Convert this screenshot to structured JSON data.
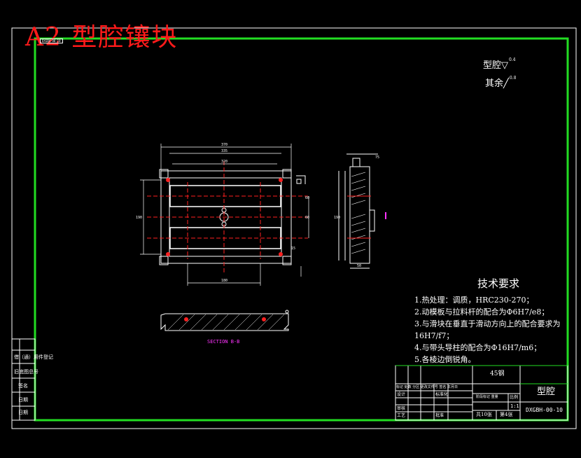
{
  "drawing": {
    "title": "A2 型腔镶块",
    "stamp": "DXGBH-00-10"
  },
  "roughness": {
    "cavity": "型腔",
    "cavity_value": "0.4",
    "rest": "其余",
    "rest_value": "0.8"
  },
  "dimensions": {
    "top_overall": "370",
    "top_inner1": "335",
    "top_inner2": "320",
    "bottom": "180",
    "left_outer": "190",
    "right_a": "60",
    "right_b": "60",
    "right_c": "15",
    "side_top": "75",
    "side_left": "190",
    "side_bottom": "50"
  },
  "section_label": "SECTION B-B",
  "tech_requirements": {
    "heading": "技术要求",
    "items": [
      "1.热处理：调质，HRC230-270；",
      "2.动模板与拉料杆的配合为Φ6H7/e8；",
      "3.与滑块在垂直于滑动方向上的配合要求为",
      "16H7/f7；",
      "4.与带头导柱的配合为Φ16H7/m6；",
      "5.各棱边倒锐角。"
    ]
  },
  "title_block": {
    "material": "45钢",
    "part_name": "型腔",
    "drawing_no": "DXGBH-00-10",
    "scale_header": "比例",
    "scale": "1:1",
    "sheets_total": "共10张",
    "sheet_no": "第4张",
    "rows": [
      "标记 处数 分区 更改文件号 签名 年月日",
      "设计",
      "审核",
      "工艺"
    ],
    "mid_labels": [
      "标准化",
      "批准"
    ],
    "stage_labels": "阶段标记 重量"
  },
  "side_panel": {
    "items": [
      "借（通）用件登记",
      "旧底图总号",
      "签名",
      "日期",
      "日期"
    ]
  }
}
